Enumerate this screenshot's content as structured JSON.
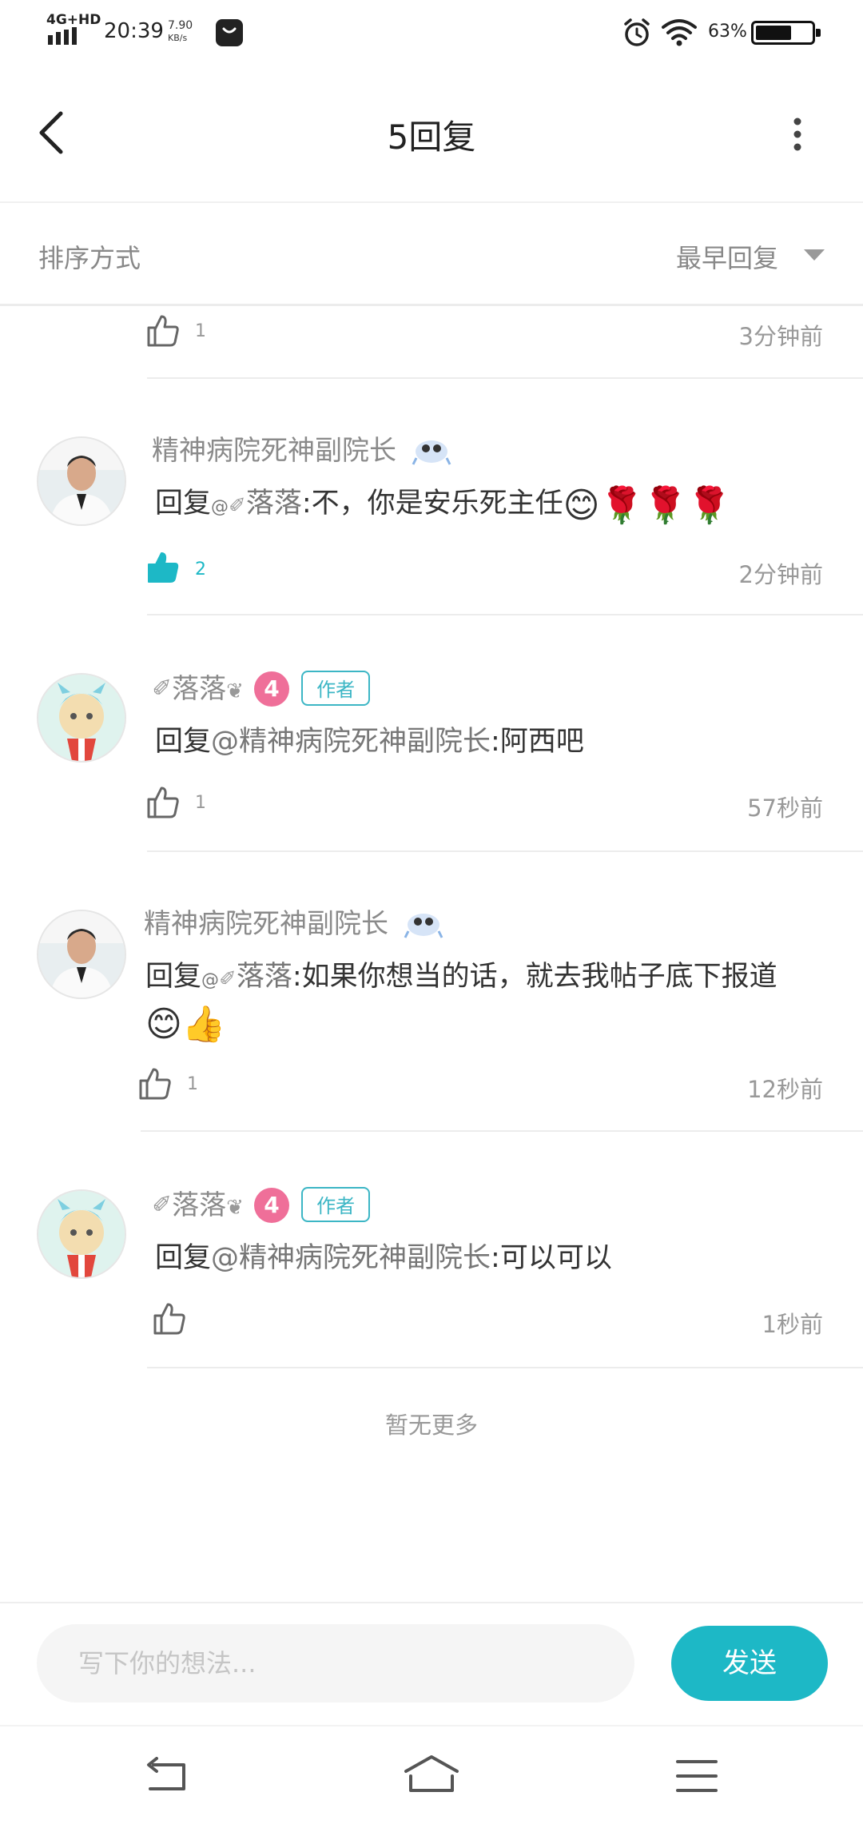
{
  "status_bar": {
    "network": "4G+HD",
    "time": "20:39",
    "speed_value": "7.90",
    "speed_unit": "KB/s",
    "battery": "63%"
  },
  "header": {
    "title": "5回复"
  },
  "sort": {
    "label": "排序方式",
    "value": "最早回复"
  },
  "partial_row": {
    "likes": "1",
    "time": "3分钟前"
  },
  "replies": [
    {
      "user": "精神病院死神副院长",
      "reply_prefix": "回复",
      "mention": "@",
      "mention_name": "落落",
      "text": ":不，你是安乐死主任",
      "emojis": "😊🌹🌹🌹",
      "likes": "2",
      "time": "2分钟前",
      "liked": true
    },
    {
      "user": "落落",
      "level": "4",
      "badge": "作者",
      "reply_prefix": "回复",
      "mention": "@精神病院死神副院长",
      "text": ":阿西吧",
      "likes": "1",
      "time": "57秒前"
    },
    {
      "user": "精神病院死神副院长",
      "reply_prefix": "回复",
      "mention": "@",
      "mention_name": "落落",
      "text": ":如果你想当的话，就去我帖子底下报道",
      "emojis": "😊👍",
      "likes": "1",
      "time": "12秒前"
    },
    {
      "user": "落落",
      "level": "4",
      "badge": "作者",
      "reply_prefix": "回复",
      "mention": "@精神病院死神副院长",
      "text": ":可以可以",
      "likes": "",
      "time": "1秒前"
    }
  ],
  "footer_note": "暂无更多",
  "input": {
    "placeholder": "写下你的想法...",
    "send_label": "发送"
  },
  "colors": {
    "accent": "#1db8c6",
    "level_badge": "#ef6f99"
  },
  "icons": [
    "back-icon",
    "more-icon",
    "dropdown-triangle-icon",
    "thumbs-up-icon",
    "nav-back-icon",
    "nav-home-icon",
    "nav-menu-icon"
  ]
}
